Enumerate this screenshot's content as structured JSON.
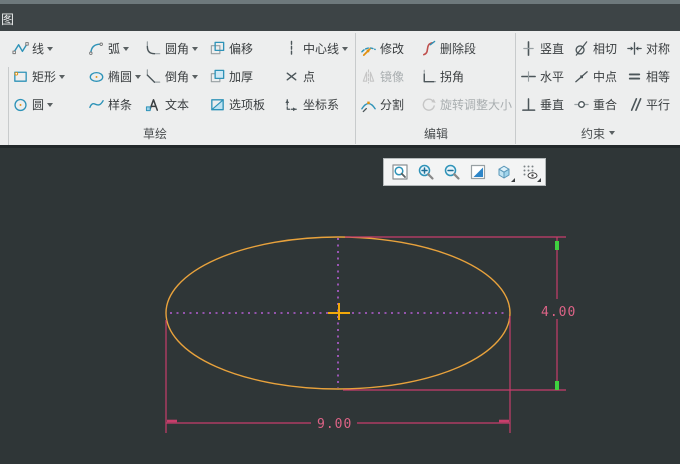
{
  "titlebar": {
    "tab_text": "图"
  },
  "ribbon": {
    "groups": [
      {
        "id": "sketch",
        "label": "草绘",
        "label_arrow": false,
        "columns": [
          {
            "buttons": [
              {
                "id": "line",
                "label": "线",
                "icon": "line-icon",
                "dropdown": true,
                "enabled": true
              },
              {
                "id": "rectangle",
                "label": "矩形",
                "icon": "rectangle-icon",
                "dropdown": true,
                "enabled": true
              },
              {
                "id": "circle",
                "label": "圆",
                "icon": "circle-icon",
                "dropdown": true,
                "enabled": true
              }
            ]
          },
          {
            "buttons": [
              {
                "id": "arc",
                "label": "弧",
                "icon": "arc-icon",
                "dropdown": true,
                "enabled": true
              },
              {
                "id": "ellipse",
                "label": "椭圆",
                "icon": "ellipse-icon",
                "dropdown": true,
                "enabled": true
              },
              {
                "id": "spline",
                "label": "样条",
                "icon": "spline-icon",
                "dropdown": false,
                "enabled": true
              }
            ]
          },
          {
            "buttons": [
              {
                "id": "fillet",
                "label": "圆角",
                "icon": "fillet-icon",
                "dropdown": true,
                "enabled": true
              },
              {
                "id": "chamfer",
                "label": "倒角",
                "icon": "chamfer-icon",
                "dropdown": true,
                "enabled": true
              },
              {
                "id": "text",
                "label": "文本",
                "icon": "text-icon",
                "dropdown": false,
                "enabled": true
              }
            ]
          },
          {
            "buttons": [
              {
                "id": "offset",
                "label": "偏移",
                "icon": "offset-icon",
                "dropdown": false,
                "enabled": true
              },
              {
                "id": "thicken",
                "label": "加厚",
                "icon": "thicken-icon",
                "dropdown": false,
                "enabled": true
              },
              {
                "id": "palette",
                "label": "选项板",
                "icon": "palette-icon",
                "dropdown": false,
                "enabled": true
              }
            ]
          },
          {
            "buttons": [
              {
                "id": "centerline",
                "label": "中心线",
                "icon": "centerline-icon",
                "dropdown": true,
                "enabled": true
              },
              {
                "id": "point",
                "label": "点",
                "icon": "point-icon",
                "dropdown": false,
                "enabled": true
              },
              {
                "id": "csys",
                "label": "坐标系",
                "icon": "csys-icon",
                "dropdown": false,
                "enabled": true
              }
            ]
          }
        ]
      },
      {
        "id": "edit",
        "label": "编辑",
        "label_arrow": false,
        "columns": [
          {
            "buttons": [
              {
                "id": "modify",
                "label": "修改",
                "icon": "modify-icon",
                "dropdown": false,
                "enabled": true
              },
              {
                "id": "mirror",
                "label": "镜像",
                "icon": "mirror-icon",
                "dropdown": false,
                "enabled": false
              },
              {
                "id": "divide",
                "label": "分割",
                "icon": "divide-icon",
                "dropdown": false,
                "enabled": true
              }
            ]
          },
          {
            "buttons": [
              {
                "id": "delete-segment",
                "label": "删除段",
                "icon": "delete-segment-icon",
                "dropdown": false,
                "enabled": true
              },
              {
                "id": "corner",
                "label": "拐角",
                "icon": "corner-icon",
                "dropdown": false,
                "enabled": true
              },
              {
                "id": "rotate-resize",
                "label": "旋转调整大小",
                "icon": "rotate-resize-icon",
                "dropdown": false,
                "enabled": false
              }
            ]
          }
        ]
      },
      {
        "id": "constrain",
        "label": "约束",
        "label_arrow": true,
        "columns": [
          {
            "buttons": [
              {
                "id": "vertical",
                "label": "竖直",
                "icon": "vertical-icon",
                "dropdown": false,
                "enabled": true
              },
              {
                "id": "horizontal",
                "label": "水平",
                "icon": "horizontal-icon",
                "dropdown": false,
                "enabled": true
              },
              {
                "id": "perpendicular",
                "label": "垂直",
                "icon": "perpendicular-icon",
                "dropdown": false,
                "enabled": true
              }
            ]
          },
          {
            "buttons": [
              {
                "id": "tangent",
                "label": "相切",
                "icon": "tangent-icon",
                "dropdown": false,
                "enabled": true
              },
              {
                "id": "midpoint",
                "label": "中点",
                "icon": "midpoint-icon",
                "dropdown": false,
                "enabled": true
              },
              {
                "id": "coincident",
                "label": "重合",
                "icon": "coincident-icon",
                "dropdown": false,
                "enabled": true
              }
            ]
          },
          {
            "buttons": [
              {
                "id": "symmetric",
                "label": "对称",
                "icon": "symmetric-icon",
                "dropdown": false,
                "enabled": true
              },
              {
                "id": "equal",
                "label": "相等",
                "icon": "equal-icon",
                "dropdown": false,
                "enabled": true
              },
              {
                "id": "parallel",
                "label": "平行",
                "icon": "parallel-icon",
                "dropdown": false,
                "enabled": true
              }
            ]
          }
        ]
      }
    ]
  },
  "viewbar": {
    "buttons": [
      {
        "id": "zoom-fit",
        "icon": "zoom-fit-icon",
        "corner_arrow": false
      },
      {
        "id": "zoom-in",
        "icon": "zoom-in-icon",
        "corner_arrow": false
      },
      {
        "id": "zoom-out",
        "icon": "zoom-out-icon",
        "corner_arrow": false
      },
      {
        "id": "repaint",
        "icon": "repaint-icon",
        "corner_arrow": false
      },
      {
        "id": "display-style",
        "icon": "display-style-icon",
        "corner_arrow": true
      },
      {
        "id": "display-filters",
        "icon": "display-filters-icon",
        "corner_arrow": true
      }
    ]
  },
  "canvas": {
    "dim_width": "9.00",
    "dim_height": "4.00"
  },
  "colors": {
    "ellipse": "#E8A23C",
    "centerline": "#B55FD3",
    "cross": "#F2A80A",
    "dimension": "#C73E6B",
    "dimension_text": "#DC6386",
    "highlight": "#3FD13F",
    "canvas_bg": "#2F3637"
  }
}
